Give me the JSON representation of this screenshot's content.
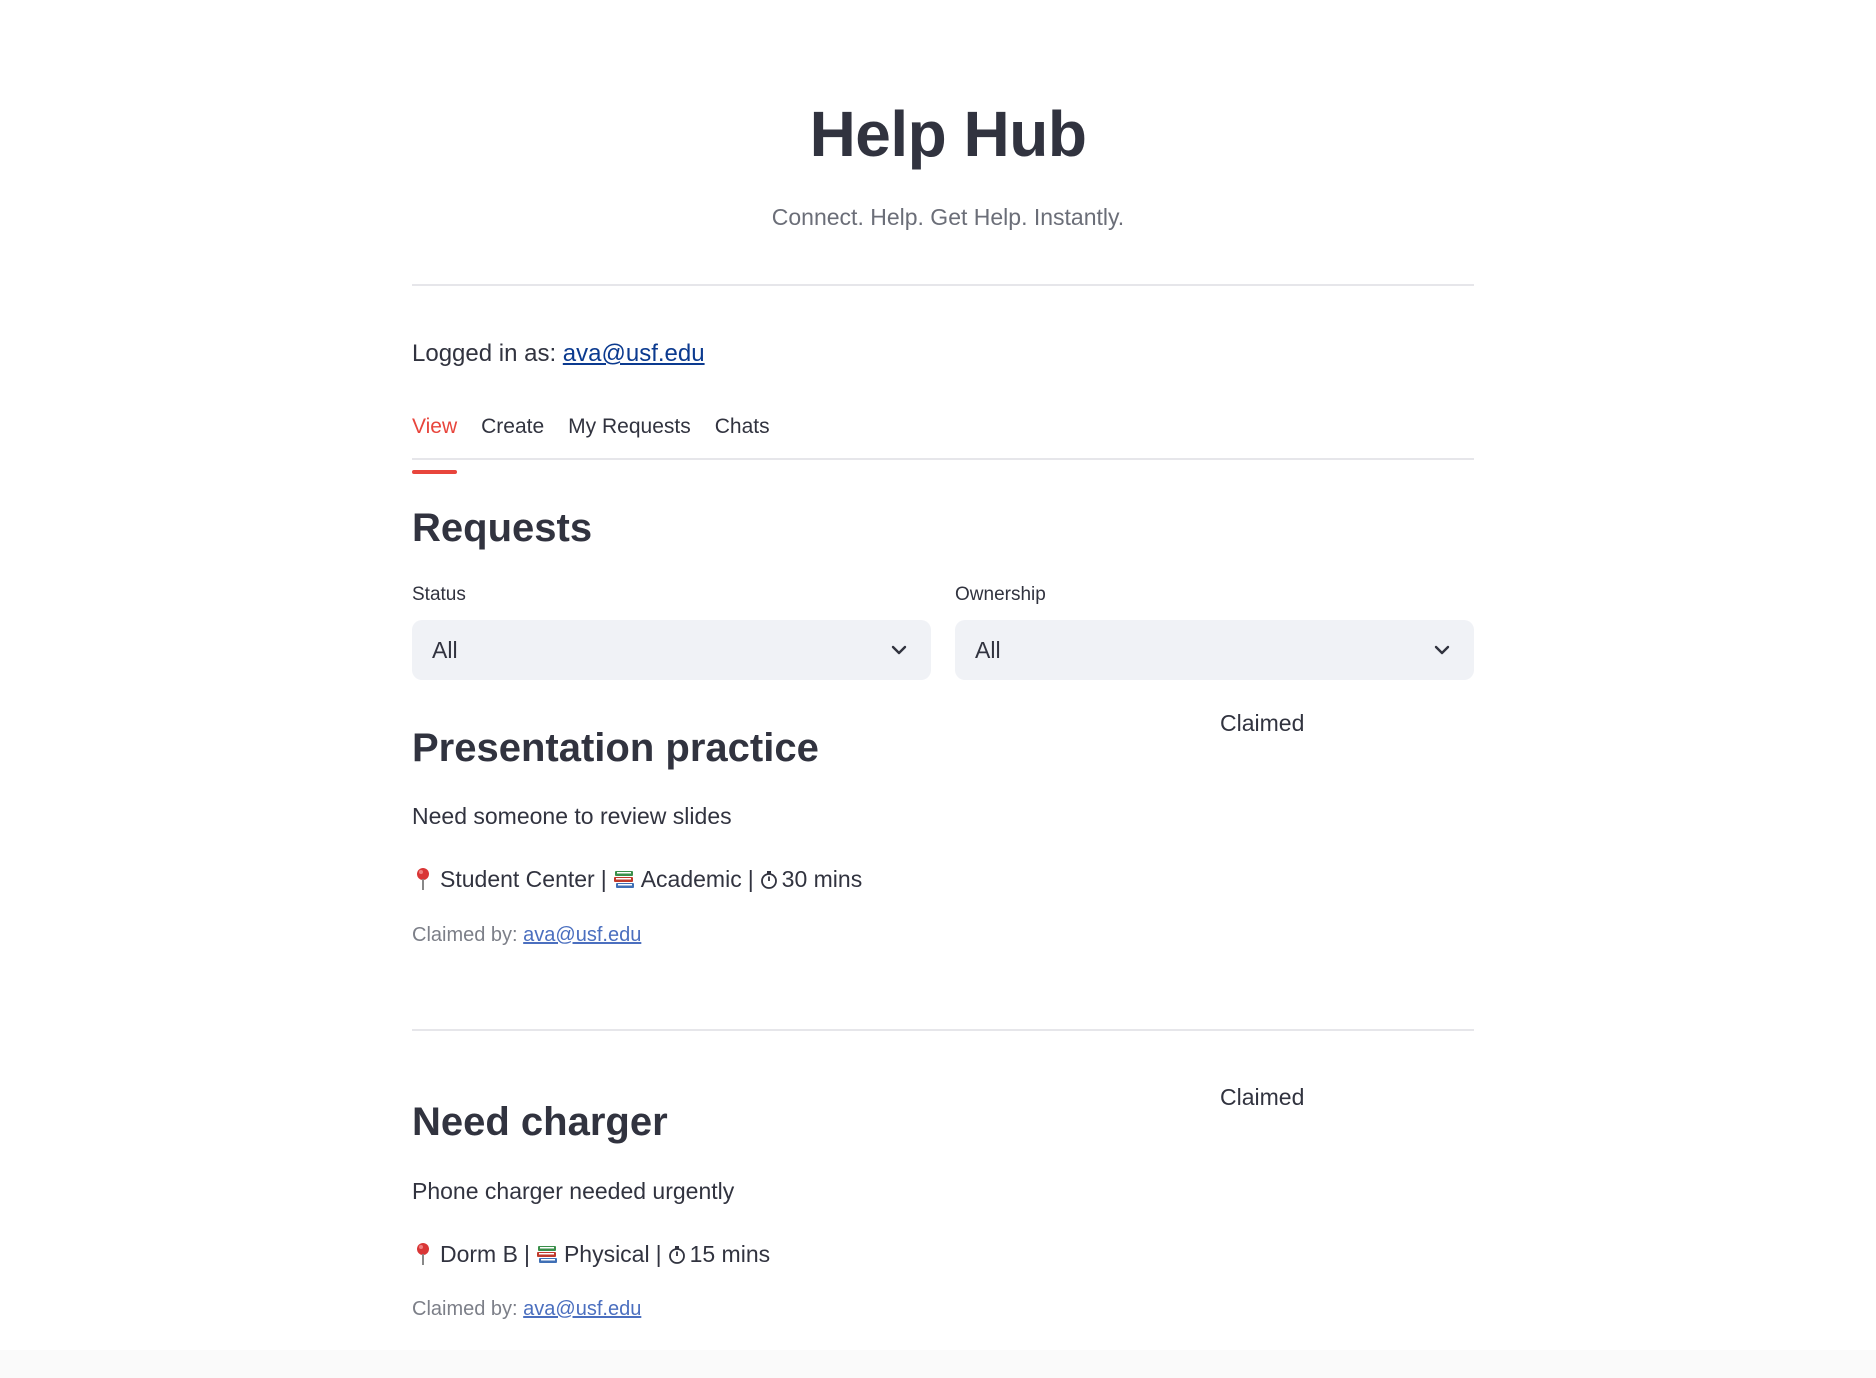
{
  "header": {
    "title": "Help Hub",
    "subtitle": "Connect. Help. Get Help. Instantly."
  },
  "session": {
    "login_prefix": "Logged in as:",
    "user_email": "ava@usf.edu"
  },
  "tabs": [
    {
      "label": "View",
      "active": true
    },
    {
      "label": "Create",
      "active": false
    },
    {
      "label": "My Requests",
      "active": false
    },
    {
      "label": "Chats",
      "active": false
    }
  ],
  "section": {
    "title": "Requests"
  },
  "filters": {
    "status": {
      "label": "Status",
      "value": "All"
    },
    "ownership": {
      "label": "Ownership",
      "value": "All"
    }
  },
  "requests": [
    {
      "title": "Presentation practice",
      "status": "Claimed",
      "description": "Need someone to review slides",
      "location": "Student Center",
      "category": "Academic",
      "duration": "30 mins",
      "claimed_by_prefix": "Claimed by:",
      "claimed_by": "ava@usf.edu"
    },
    {
      "title": "Need charger",
      "status": "Claimed",
      "description": "Phone charger needed urgently",
      "location": "Dorm B",
      "category": "Physical",
      "duration": "15 mins",
      "claimed_by_prefix": "Claimed by:",
      "claimed_by": "ava@usf.edu"
    }
  ],
  "icons": {
    "location": "pushpin-icon",
    "category": "books-icon",
    "duration": "stopwatch-icon",
    "chevron": "chevron-down-icon"
  },
  "colors": {
    "accent": "#e8453c",
    "link": "#0b3a8f",
    "select_bg": "#f0f2f6",
    "text": "#31333f",
    "muted": "#7c7f88"
  }
}
